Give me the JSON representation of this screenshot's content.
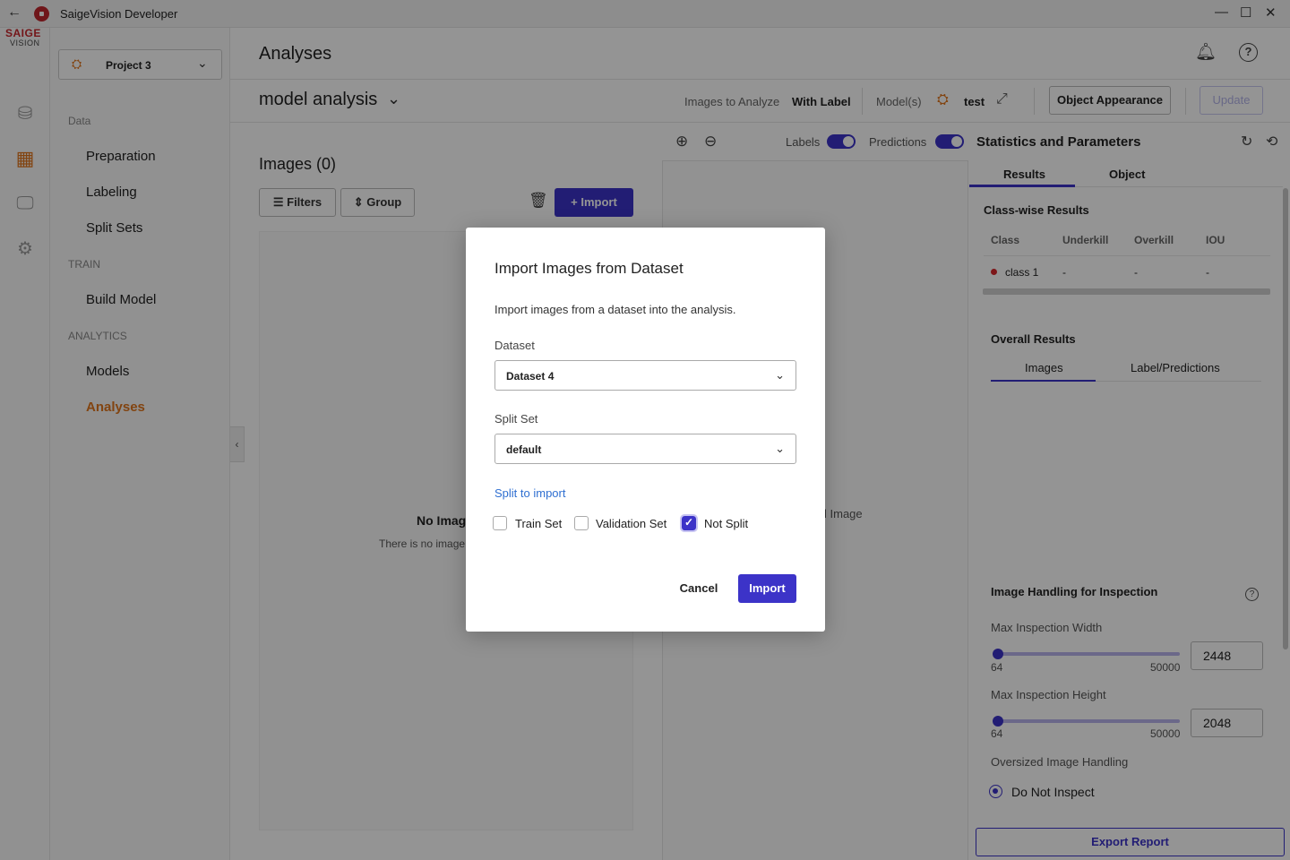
{
  "window": {
    "title": "SaigeVision Developer",
    "back_icon": "arrow-left-icon",
    "controls": [
      "—",
      "☐",
      "✕"
    ]
  },
  "brand": {
    "top": "SAIGE",
    "bottom": "VISION"
  },
  "rail": {
    "icons": [
      "database-icon",
      "grid-icon",
      "monitor-icon",
      "gear-icon"
    ]
  },
  "project": {
    "label": "Project 3",
    "icon": "project-icon"
  },
  "nav": {
    "sections": [
      "Data",
      "TRAIN",
      "ANALYTICS"
    ],
    "items": [
      "Preparation",
      "Labeling",
      "Split Sets",
      "Build Model",
      "Models",
      "Analyses"
    ],
    "active": "Analyses"
  },
  "header": {
    "page_title": "Analyses",
    "analysis_name": "model analysis",
    "images_to_analyze_label": "Images to Analyze",
    "images_to_analyze_value": "With Label",
    "models_label": "Model(s)",
    "model_value": "test",
    "object_appearance": "Object Appearance",
    "update": "Update"
  },
  "images_panel": {
    "title": "Images (0)",
    "filters": "Filters",
    "group": "Group",
    "import": "Import",
    "empty_title": "No Imag",
    "empty_desc": "There is no image"
  },
  "viewer": {
    "labels_toggle": "Labels",
    "predictions_toggle": "Predictions",
    "empty_text": "l Image"
  },
  "stats": {
    "title": "Statistics and Parameters",
    "tabs": [
      "Results",
      "Object"
    ],
    "classwise_title": "Class-wise Results",
    "columns": [
      "Class",
      "Underkill",
      "Overkill",
      "IOU"
    ],
    "rows": [
      {
        "class": "class 1",
        "underkill": "-",
        "overkill": "-",
        "iou": "-",
        "color": "#d8262b"
      }
    ],
    "overall_title": "Overall Results",
    "overall_tabs": [
      "Images",
      "Label/Predictions"
    ],
    "image_handling_title": "Image Handling for Inspection",
    "max_width_label": "Max Inspection Width",
    "max_width": {
      "min": "64",
      "max": "50000",
      "value": "2448"
    },
    "max_height_label": "Max Inspection Height",
    "max_height": {
      "min": "64",
      "max": "50000",
      "value": "2048"
    },
    "oversized_label": "Oversized Image Handling",
    "oversized_option": "Do Not Inspect",
    "export": "Export Report"
  },
  "modal": {
    "title": "Import Images from Dataset",
    "description": "Import images from a dataset into the analysis.",
    "dataset_label": "Dataset",
    "dataset_value": "Dataset 4",
    "split_label": "Split Set",
    "split_value": "default",
    "split_to_import": "Split to import",
    "options": [
      {
        "label": "Train Set",
        "checked": false
      },
      {
        "label": "Validation Set",
        "checked": false
      },
      {
        "label": "Not Split",
        "checked": true
      }
    ],
    "cancel": "Cancel",
    "import": "Import"
  },
  "colors": {
    "accent": "#3c33c8",
    "brand": "#c8262c",
    "nav_active": "#e0751d",
    "link": "#2f6fd1"
  }
}
